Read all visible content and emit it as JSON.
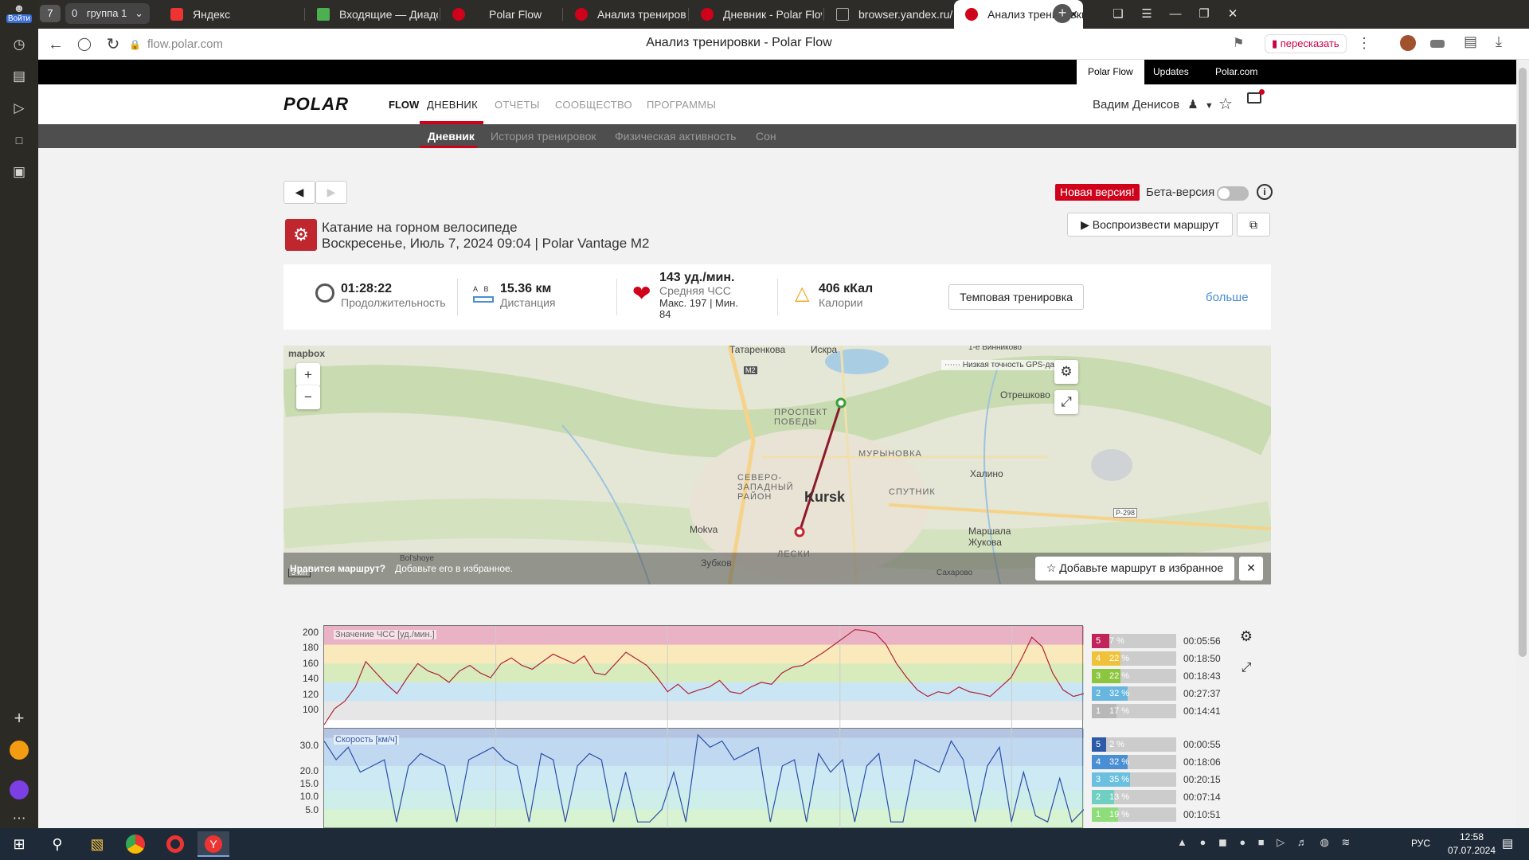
{
  "browser": {
    "left_panel": {
      "login_label": "Войти",
      "badge": "7"
    },
    "tabs": [
      {
        "label": "группа 1",
        "count": "0",
        "badge": "7"
      },
      {
        "label": "Яндекс"
      },
      {
        "label": "Входящие — Диадок"
      },
      {
        "label": "Polar Flow"
      },
      {
        "label": "Анализ тренировки - Pola"
      },
      {
        "label": "Дневник - Polar Flow"
      },
      {
        "label": "browser.yandex.ru/c/alice"
      },
      {
        "label": "Анализ тренировки - P"
      }
    ],
    "address": "flow.polar.com",
    "page_title": "Анализ тренировки - Polar Flow",
    "retell_label": "пересказать"
  },
  "polar": {
    "top_links": [
      "Polar Flow",
      "Updates",
      "Polar.com"
    ],
    "logo": "POLAR",
    "flow": "FLOW",
    "main_nav": [
      "ДНЕВНИК",
      "ОТЧЕТЫ",
      "СООБЩЕСТВО",
      "ПРОГРАММЫ"
    ],
    "user": "Вадим Денисов",
    "sub_nav": [
      "Дневник",
      "История тренировок",
      "Физическая активность",
      "Сон"
    ]
  },
  "session": {
    "new_version": "Новая версия!",
    "beta": "Бета-версия",
    "sport": "Катание на горном велосипеде",
    "date_device": "Воскресенье, Июль 7, 2024 09:04 | Polar Vantage M2",
    "replay": "Воспроизвести маршрут",
    "duration": {
      "value": "01:28:22",
      "label": "Продолжительность"
    },
    "distance": {
      "value": "15.36 км",
      "label": "Дистанция",
      "a": "A",
      "b": "B"
    },
    "hr": {
      "value": "143 уд./мин.",
      "label": "Средняя ЧСС",
      "maxmin": "Макс. 197  |  Мин.",
      "min": "84"
    },
    "calories": {
      "value": "406 кКал",
      "label": "Калории"
    },
    "tempo": "Темповая тренировка",
    "more": "больше"
  },
  "map": {
    "attribution": "mapbox",
    "legend": "Низкая точность GPS-данных",
    "labels": {
      "tatarenkova": "Татаренкова",
      "iskra": "Искра",
      "vinnikovo": "1-е Винниково",
      "otreshkovo": "Отрешково",
      "prospekt": "ПРОСПЕКТ ПОБЕДЫ",
      "muryn": "МУРЫНОВКА",
      "khalino": "Халино",
      "severo": "СЕВЕРО-ЗАПАДНЫЙ РАЙОН",
      "kursk": "Kursk",
      "sputnik": "СПУТНИК",
      "mokva": "Mokva",
      "marsh": "Маршала Жукова",
      "zubkov": "Зубков",
      "bolshoye": "Bol'shoye",
      "sakharovo": "Сахарово",
      "leski": "ЛЕСКИ",
      "m2": "M2",
      "r298": "Р-298",
      "scale": "3 km"
    },
    "banner_q": "Нравится маршрут?",
    "banner_hint": "Добавьте его в избранное.",
    "fav_button": "Добавьте маршрут в избранное"
  },
  "charts": {
    "hr_label": "Значение ЧСС [уд./мин.]",
    "speed_label": "Скорость [км/ч]",
    "hr_ticks": [
      "200",
      "180",
      "160",
      "140",
      "120",
      "100"
    ],
    "speed_ticks": [
      "30.0",
      "20.0",
      "15.0",
      "10.0",
      "5.0"
    ],
    "hr_zones": [
      {
        "n": "5",
        "pct": "7 %",
        "time": "00:05:56",
        "frac": 0.07,
        "color": "#c0245a"
      },
      {
        "n": "4",
        "pct": "22 %",
        "time": "00:18:50",
        "frac": 0.22,
        "color": "#f0c23b"
      },
      {
        "n": "3",
        "pct": "22 %",
        "time": "00:18:43",
        "frac": 0.22,
        "color": "#8cc63f"
      },
      {
        "n": "2",
        "pct": "32 %",
        "time": "00:27:37",
        "frac": 0.32,
        "color": "#67b6e0"
      },
      {
        "n": "1",
        "pct": "17 %",
        "time": "00:14:41",
        "frac": 0.17,
        "color": "#b8b8b8"
      }
    ],
    "speed_zones": [
      {
        "n": "5",
        "pct": "2 %",
        "time": "00:00:55",
        "frac": 0.02,
        "color": "#2b5aa8"
      },
      {
        "n": "4",
        "pct": "32 %",
        "time": "00:18:06",
        "frac": 0.32,
        "color": "#4a8fd4"
      },
      {
        "n": "3",
        "pct": "35 %",
        "time": "00:20:15",
        "frac": 0.35,
        "color": "#6cc0df"
      },
      {
        "n": "2",
        "pct": "13 %",
        "time": "00:07:14",
        "frac": 0.13,
        "color": "#6fcfc0"
      },
      {
        "n": "1",
        "pct": "19 %",
        "time": "00:10:51",
        "frac": 0.19,
        "color": "#8fdc7a"
      }
    ]
  },
  "chart_data": [
    {
      "type": "line",
      "ylabel": "Значение ЧСС [уд./мин.]",
      "ylim": [
        90,
        200
      ],
      "series": [
        {
          "values": [
            95,
            112,
            120,
            135,
            162,
            150,
            138,
            128,
            145,
            160,
            152,
            148,
            140,
            152,
            158,
            150,
            145,
            160,
            166,
            158,
            154,
            162,
            170,
            165,
            160,
            168,
            150,
            148,
            160,
            172,
            165,
            158,
            145,
            130,
            138,
            128,
            132,
            135,
            142,
            130,
            128,
            135,
            140,
            138,
            150,
            156,
            158,
            165,
            172,
            180,
            188,
            196,
            195,
            192,
            180,
            160,
            145,
            132,
            125,
            130,
            128,
            135,
            130,
            128,
            125,
            135,
            145,
            165,
            188,
            178,
            150,
            132,
            125,
            128
          ]
        }
      ]
    },
    {
      "type": "line",
      "ylabel": "Скорость [км/ч]",
      "ylim": [
        0,
        32
      ],
      "series": [
        {
          "values": [
            28,
            22,
            26,
            18,
            20,
            22,
            2,
            20,
            24,
            22,
            20,
            2,
            22,
            24,
            26,
            22,
            20,
            2,
            24,
            22,
            2,
            20,
            24,
            22,
            2,
            18,
            2,
            2,
            6,
            18,
            2,
            30,
            26,
            28,
            22,
            24,
            26,
            2,
            20,
            22,
            2,
            24,
            18,
            22,
            2,
            20,
            24,
            2,
            2,
            22,
            20,
            18,
            28,
            22,
            2,
            20,
            26,
            2,
            18,
            4,
            2,
            16,
            2,
            6
          ]
        }
      ]
    }
  ],
  "taskbar": {
    "lang": "РУС",
    "time": "12:58",
    "date": "07.07.2024"
  }
}
